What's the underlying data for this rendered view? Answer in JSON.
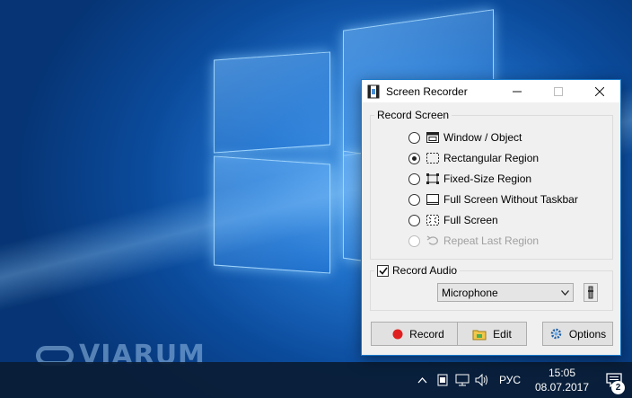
{
  "window": {
    "title": "Screen Recorder",
    "controls": {
      "minimize_icon": "minimize-icon",
      "maximize_icon": "maximize-icon",
      "close_icon": "close-icon"
    }
  },
  "record_screen": {
    "legend": "Record Screen",
    "options": [
      {
        "label": "Window / Object",
        "icon": "window-object-icon",
        "checked": false,
        "enabled": true
      },
      {
        "label": "Rectangular Region",
        "icon": "rectangular-region-icon",
        "checked": true,
        "enabled": true
      },
      {
        "label": "Fixed-Size Region",
        "icon": "fixed-size-region-icon",
        "checked": false,
        "enabled": true
      },
      {
        "label": "Full Screen Without Taskbar",
        "icon": "screen-without-taskbar-icon",
        "checked": false,
        "enabled": true
      },
      {
        "label": "Full Screen",
        "icon": "full-screen-icon",
        "checked": false,
        "enabled": true
      },
      {
        "label": "Repeat Last Region",
        "icon": "repeat-icon",
        "checked": false,
        "enabled": false
      }
    ]
  },
  "audio": {
    "label": "Record Audio",
    "checked": true,
    "device": "Microphone"
  },
  "buttons": {
    "record": "Record",
    "edit": "Edit",
    "options": "Options"
  },
  "taskbar": {
    "language": "РУС",
    "time": "15:05",
    "date": "08.07.2017",
    "notification_count": "2"
  },
  "watermark": "VIARUM",
  "colors": {
    "accent": "#1979ca",
    "record_red": "#e02020",
    "desktop": "#1f6fc8",
    "taskbar": "#0a1c34"
  }
}
